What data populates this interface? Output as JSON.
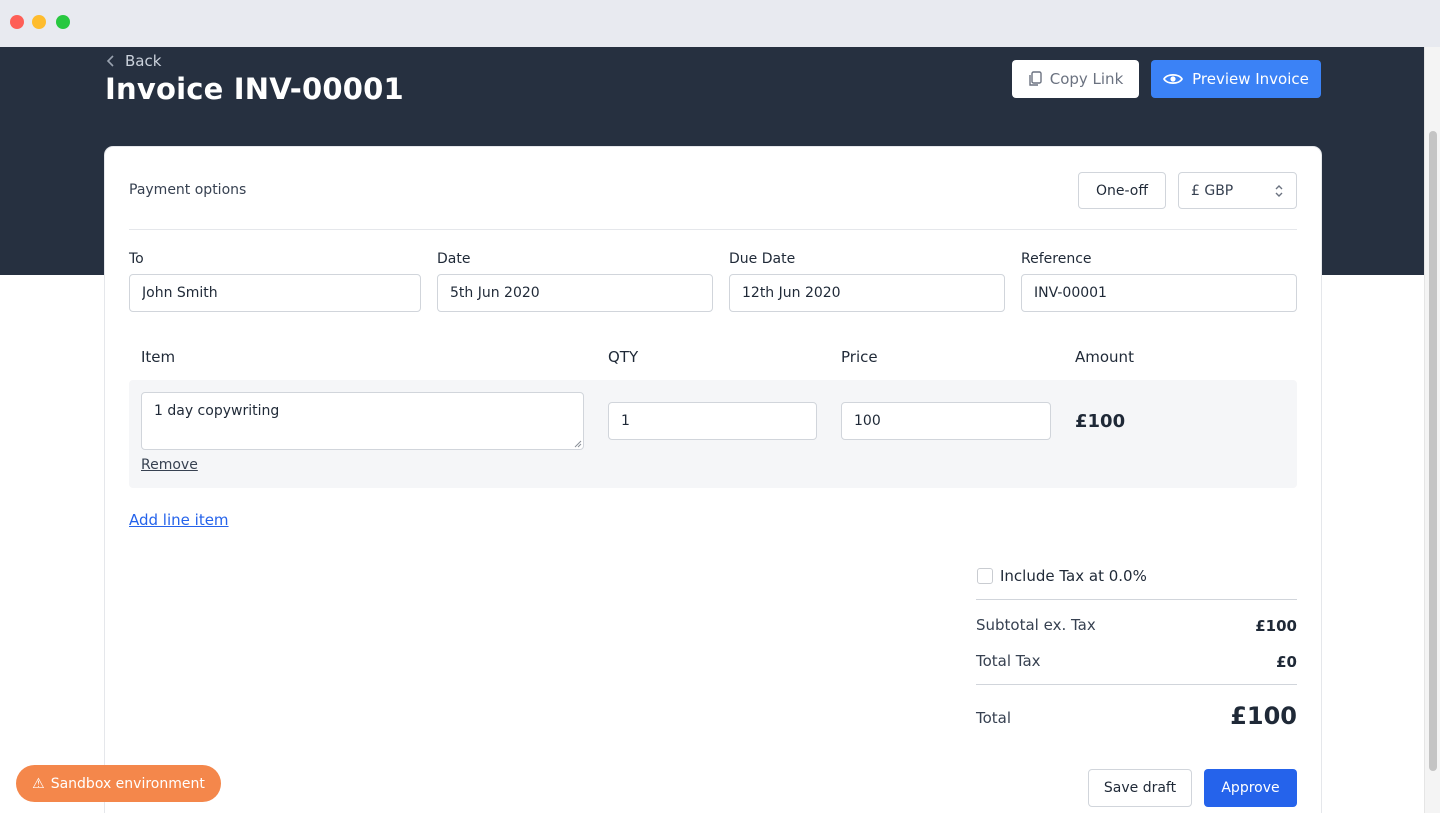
{
  "window": {
    "controls": [
      "close",
      "minimize",
      "maximize"
    ]
  },
  "header": {
    "back_label": "Back",
    "title": "Invoice INV-00001",
    "copy_link_label": "Copy Link",
    "preview_label": "Preview Invoice"
  },
  "payment": {
    "label": "Payment options",
    "frequency": "One-off",
    "currency": "£ GBP"
  },
  "fields": {
    "to": {
      "label": "To",
      "value": "John Smith"
    },
    "date": {
      "label": "Date",
      "value": "5th Jun 2020"
    },
    "due_date": {
      "label": "Due Date",
      "value": "12th Jun 2020"
    },
    "reference": {
      "label": "Reference",
      "value": "INV-00001"
    }
  },
  "line_items": {
    "headers": {
      "item": "Item",
      "qty": "QTY",
      "price": "Price",
      "amount": "Amount"
    },
    "rows": [
      {
        "item": "1 day copywriting",
        "qty": "1",
        "price": "100",
        "amount": "£100",
        "remove_label": "Remove"
      }
    ],
    "add_label": "Add line item"
  },
  "summary": {
    "tax_label": "Include Tax at 0.0%",
    "tax_checked": false,
    "subtotal_label": "Subtotal ex. Tax",
    "subtotal_value": "£100",
    "tax_total_label": "Total Tax",
    "tax_total_value": "£0",
    "total_label": "Total",
    "total_value": "£100"
  },
  "actions": {
    "save_draft_label": "Save draft",
    "approve_label": "Approve"
  },
  "sandbox": {
    "label": "Sandbox environment"
  },
  "colors": {
    "header_bg": "#263040",
    "primary": "#2563eb",
    "preview": "#3b82f6",
    "sandbox": "#f4874b"
  },
  "icons": {
    "back": "chevron-left-icon",
    "copy": "copy-icon",
    "preview": "eye-icon",
    "select": "select-arrows-icon",
    "warning": "warning-icon"
  }
}
